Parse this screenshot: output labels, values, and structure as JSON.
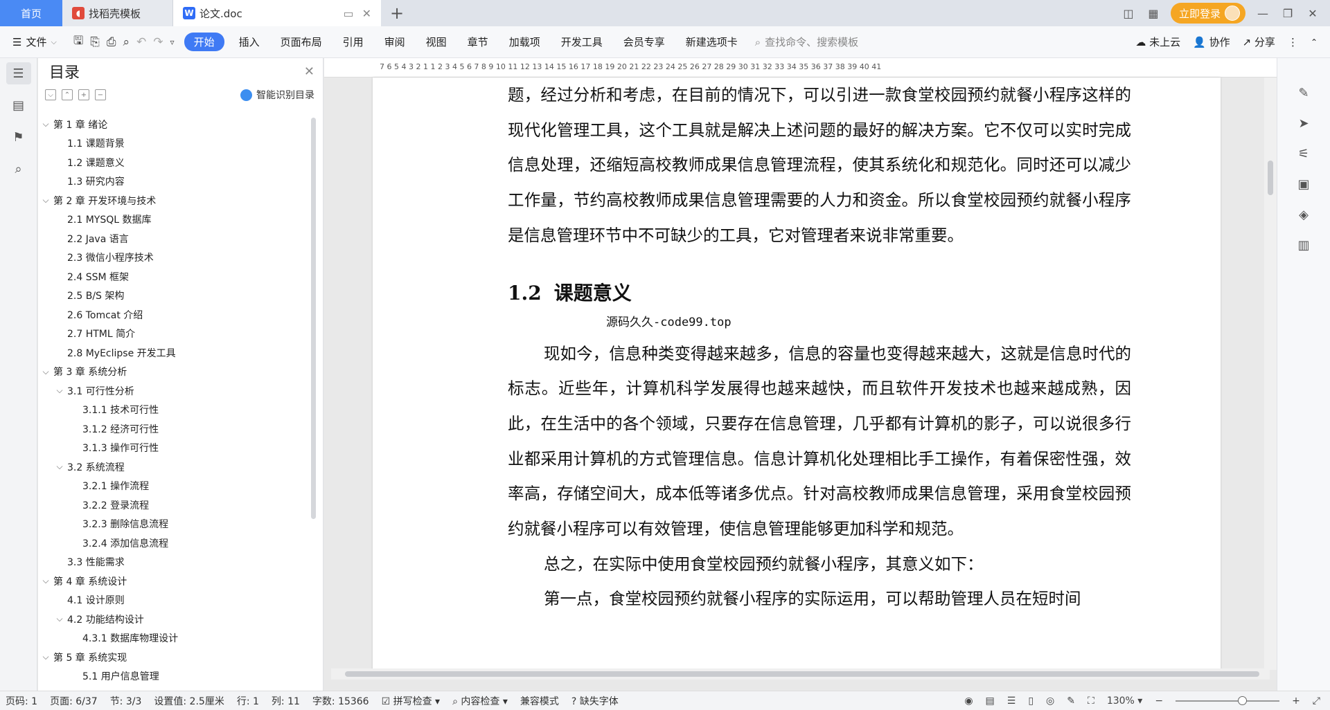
{
  "tabs": {
    "home": "首页",
    "template": "找稻壳模板",
    "document": "论文.doc",
    "login": "立即登录"
  },
  "ribbon": {
    "file": "文件",
    "menus": [
      "开始",
      "插入",
      "页面布局",
      "引用",
      "审阅",
      "视图",
      "章节",
      "加载项",
      "开发工具",
      "会员专享",
      "新建选项卡"
    ],
    "search_placeholder": "查找命令、搜索模板",
    "cloud": "未上云",
    "collab": "协作",
    "share": "分享"
  },
  "toc": {
    "title": "目录",
    "smart": "智能识别目录",
    "items": [
      {
        "label": "第 1 章  绪论",
        "level": 1,
        "expand": true
      },
      {
        "label": "1.1  课题背景",
        "level": 2,
        "expand": false
      },
      {
        "label": "1.2  课题意义",
        "level": 2,
        "expand": false
      },
      {
        "label": "1.3  研究内容",
        "level": 2,
        "expand": false
      },
      {
        "label": "第 2 章  开发环境与技术",
        "level": 1,
        "expand": true
      },
      {
        "label": "2.1  MYSQL 数据库",
        "level": 2,
        "expand": false
      },
      {
        "label": "2.2 Java 语言",
        "level": 2,
        "expand": false
      },
      {
        "label": "2.3  微信小程序技术",
        "level": 2,
        "expand": false
      },
      {
        "label": "2.4 SSM 框架",
        "level": 2,
        "expand": false
      },
      {
        "label": "2.5 B/S 架构",
        "level": 2,
        "expand": false
      },
      {
        "label": "2.6 Tomcat  介绍",
        "level": 2,
        "expand": false
      },
      {
        "label": "2.7 HTML 简介",
        "level": 2,
        "expand": false
      },
      {
        "label": "2.8 MyEclipse 开发工具",
        "level": 2,
        "expand": false
      },
      {
        "label": "第 3 章  系统分析",
        "level": 1,
        "expand": true
      },
      {
        "label": "3.1  可行性分析",
        "level": 2,
        "expand": true
      },
      {
        "label": "3.1.1  技术可行性",
        "level": 3,
        "expand": false
      },
      {
        "label": "3.1.2  经济可行性",
        "level": 3,
        "expand": false
      },
      {
        "label": "3.1.3  操作可行性",
        "level": 3,
        "expand": false
      },
      {
        "label": "3.2  系统流程",
        "level": 2,
        "expand": true
      },
      {
        "label": "3.2.1  操作流程",
        "level": 3,
        "expand": false
      },
      {
        "label": "3.2.2  登录流程",
        "level": 3,
        "expand": false
      },
      {
        "label": "3.2.3  删除信息流程",
        "level": 3,
        "expand": false
      },
      {
        "label": "3.2.4  添加信息流程",
        "level": 3,
        "expand": false
      },
      {
        "label": "3.3  性能需求",
        "level": 2,
        "expand": false
      },
      {
        "label": "第 4 章  系统设计",
        "level": 1,
        "expand": true
      },
      {
        "label": "4.1  设计原则",
        "level": 2,
        "expand": false
      },
      {
        "label": "4.2  功能结构设计",
        "level": 2,
        "expand": true
      },
      {
        "label": "4.3.1  数据库物理设计",
        "level": 3,
        "expand": false
      },
      {
        "label": "第 5 章  系统实现",
        "level": 1,
        "expand": true
      },
      {
        "label": "5.1 用户信息管理",
        "level": 3,
        "expand": false
      }
    ]
  },
  "ruler": {
    "numbers": "7   6   5   4   3   2   1       1   2   3   4   5   6   7   8   9  10  11  12  13  14  15  16  17  18  19  20  21  22  23  24  25  26  27  28  29  30  31  32  33  34  35  36  37  38  39  40  41"
  },
  "document": {
    "para1": "题，经过分析和考虑，在目前的情况下，可以引进一款食堂校园预约就餐小程序这样的现代化管理工具，这个工具就是解决上述问题的最好的解决方案。它不仅可以实时完成信息处理，还缩短高校教师成果信息管理流程，使其系统化和规范化。同时还可以减少工作量，节约高校教师成果信息管理需要的人力和资金。所以食堂校园预约就餐小程序是信息管理环节中不可缺少的工具，它对管理者来说非常重要。",
    "heading_num": "1.2",
    "heading_text": "课题意义",
    "watermark": "源码久久-code99.top",
    "para2": "现如今，信息种类变得越来越多，信息的容量也变得越来越大，这就是信息时代的标志。近些年，计算机科学发展得也越来越快，而且软件开发技术也越来越成熟，因此，在生活中的各个领域，只要存在信息管理，几乎都有计算机的影子，可以说很多行业都采用计算机的方式管理信息。信息计算机化处理相比手工操作，有着保密性强，效率高，存储空间大，成本低等诸多优点。针对高校教师成果信息管理，采用食堂校园预约就餐小程序可以有效管理，使信息管理能够更加科学和规范。",
    "para3": "总之，在实际中使用食堂校园预约就餐小程序，其意义如下：",
    "para4": "第一点，食堂校园预约就餐小程序的实际运用，可以帮助管理人员在短时间"
  },
  "status": {
    "page_code": "页码: 1",
    "page": "页面: 6/37",
    "section": "节: 3/3",
    "setting": "设置值: 2.5厘米",
    "row": "行: 1",
    "col": "列: 11",
    "words": "字数: 15366",
    "spell": "拼写检查",
    "content_check": "内容检查",
    "compat": "兼容模式",
    "missing_font": "缺失字体",
    "zoom": "130%"
  }
}
